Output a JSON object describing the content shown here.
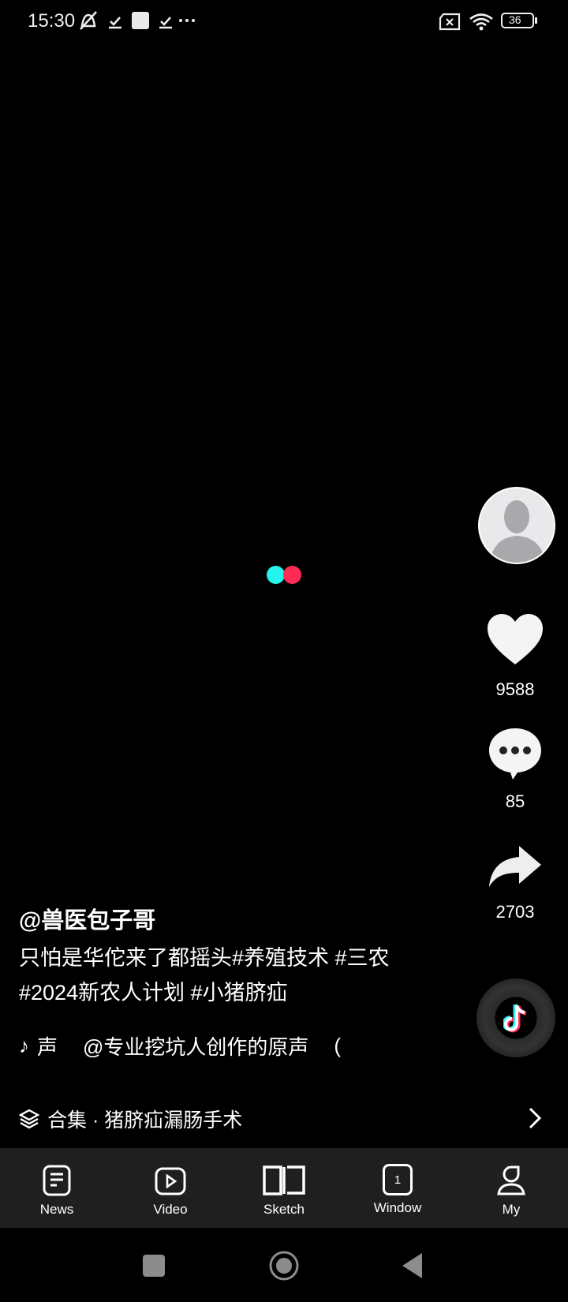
{
  "status_bar": {
    "time": "15:30",
    "battery": "36",
    "icons": [
      "mute-icon",
      "check-icon",
      "square-icon",
      "check-icon",
      "more-icon",
      "sim-off-icon",
      "wifi-icon",
      "battery-icon"
    ]
  },
  "loading_colors": [
    "#25f4ee",
    "#fe2c55"
  ],
  "actions": {
    "likes": "9588",
    "comments": "85",
    "shares": "2703"
  },
  "post": {
    "username": "@兽医包子哥",
    "description": "只怕是华佗来了都摇头#养殖技术 #三农 #2024新农人计划 #小猪脐疝",
    "music_prefix": "声",
    "music": "@专业挖坑人创作的原声",
    "music_trail": "(",
    "collection": "合集 · 猪脐疝漏肠手术"
  },
  "tabs": [
    {
      "label": "News",
      "icon": "news-icon"
    },
    {
      "label": "Video",
      "icon": "video-icon"
    },
    {
      "label": "Sketch",
      "icon": "book-icon"
    },
    {
      "label": "Window",
      "icon": "window-icon",
      "badge": "1"
    },
    {
      "label": "My",
      "icon": "person-icon"
    }
  ]
}
